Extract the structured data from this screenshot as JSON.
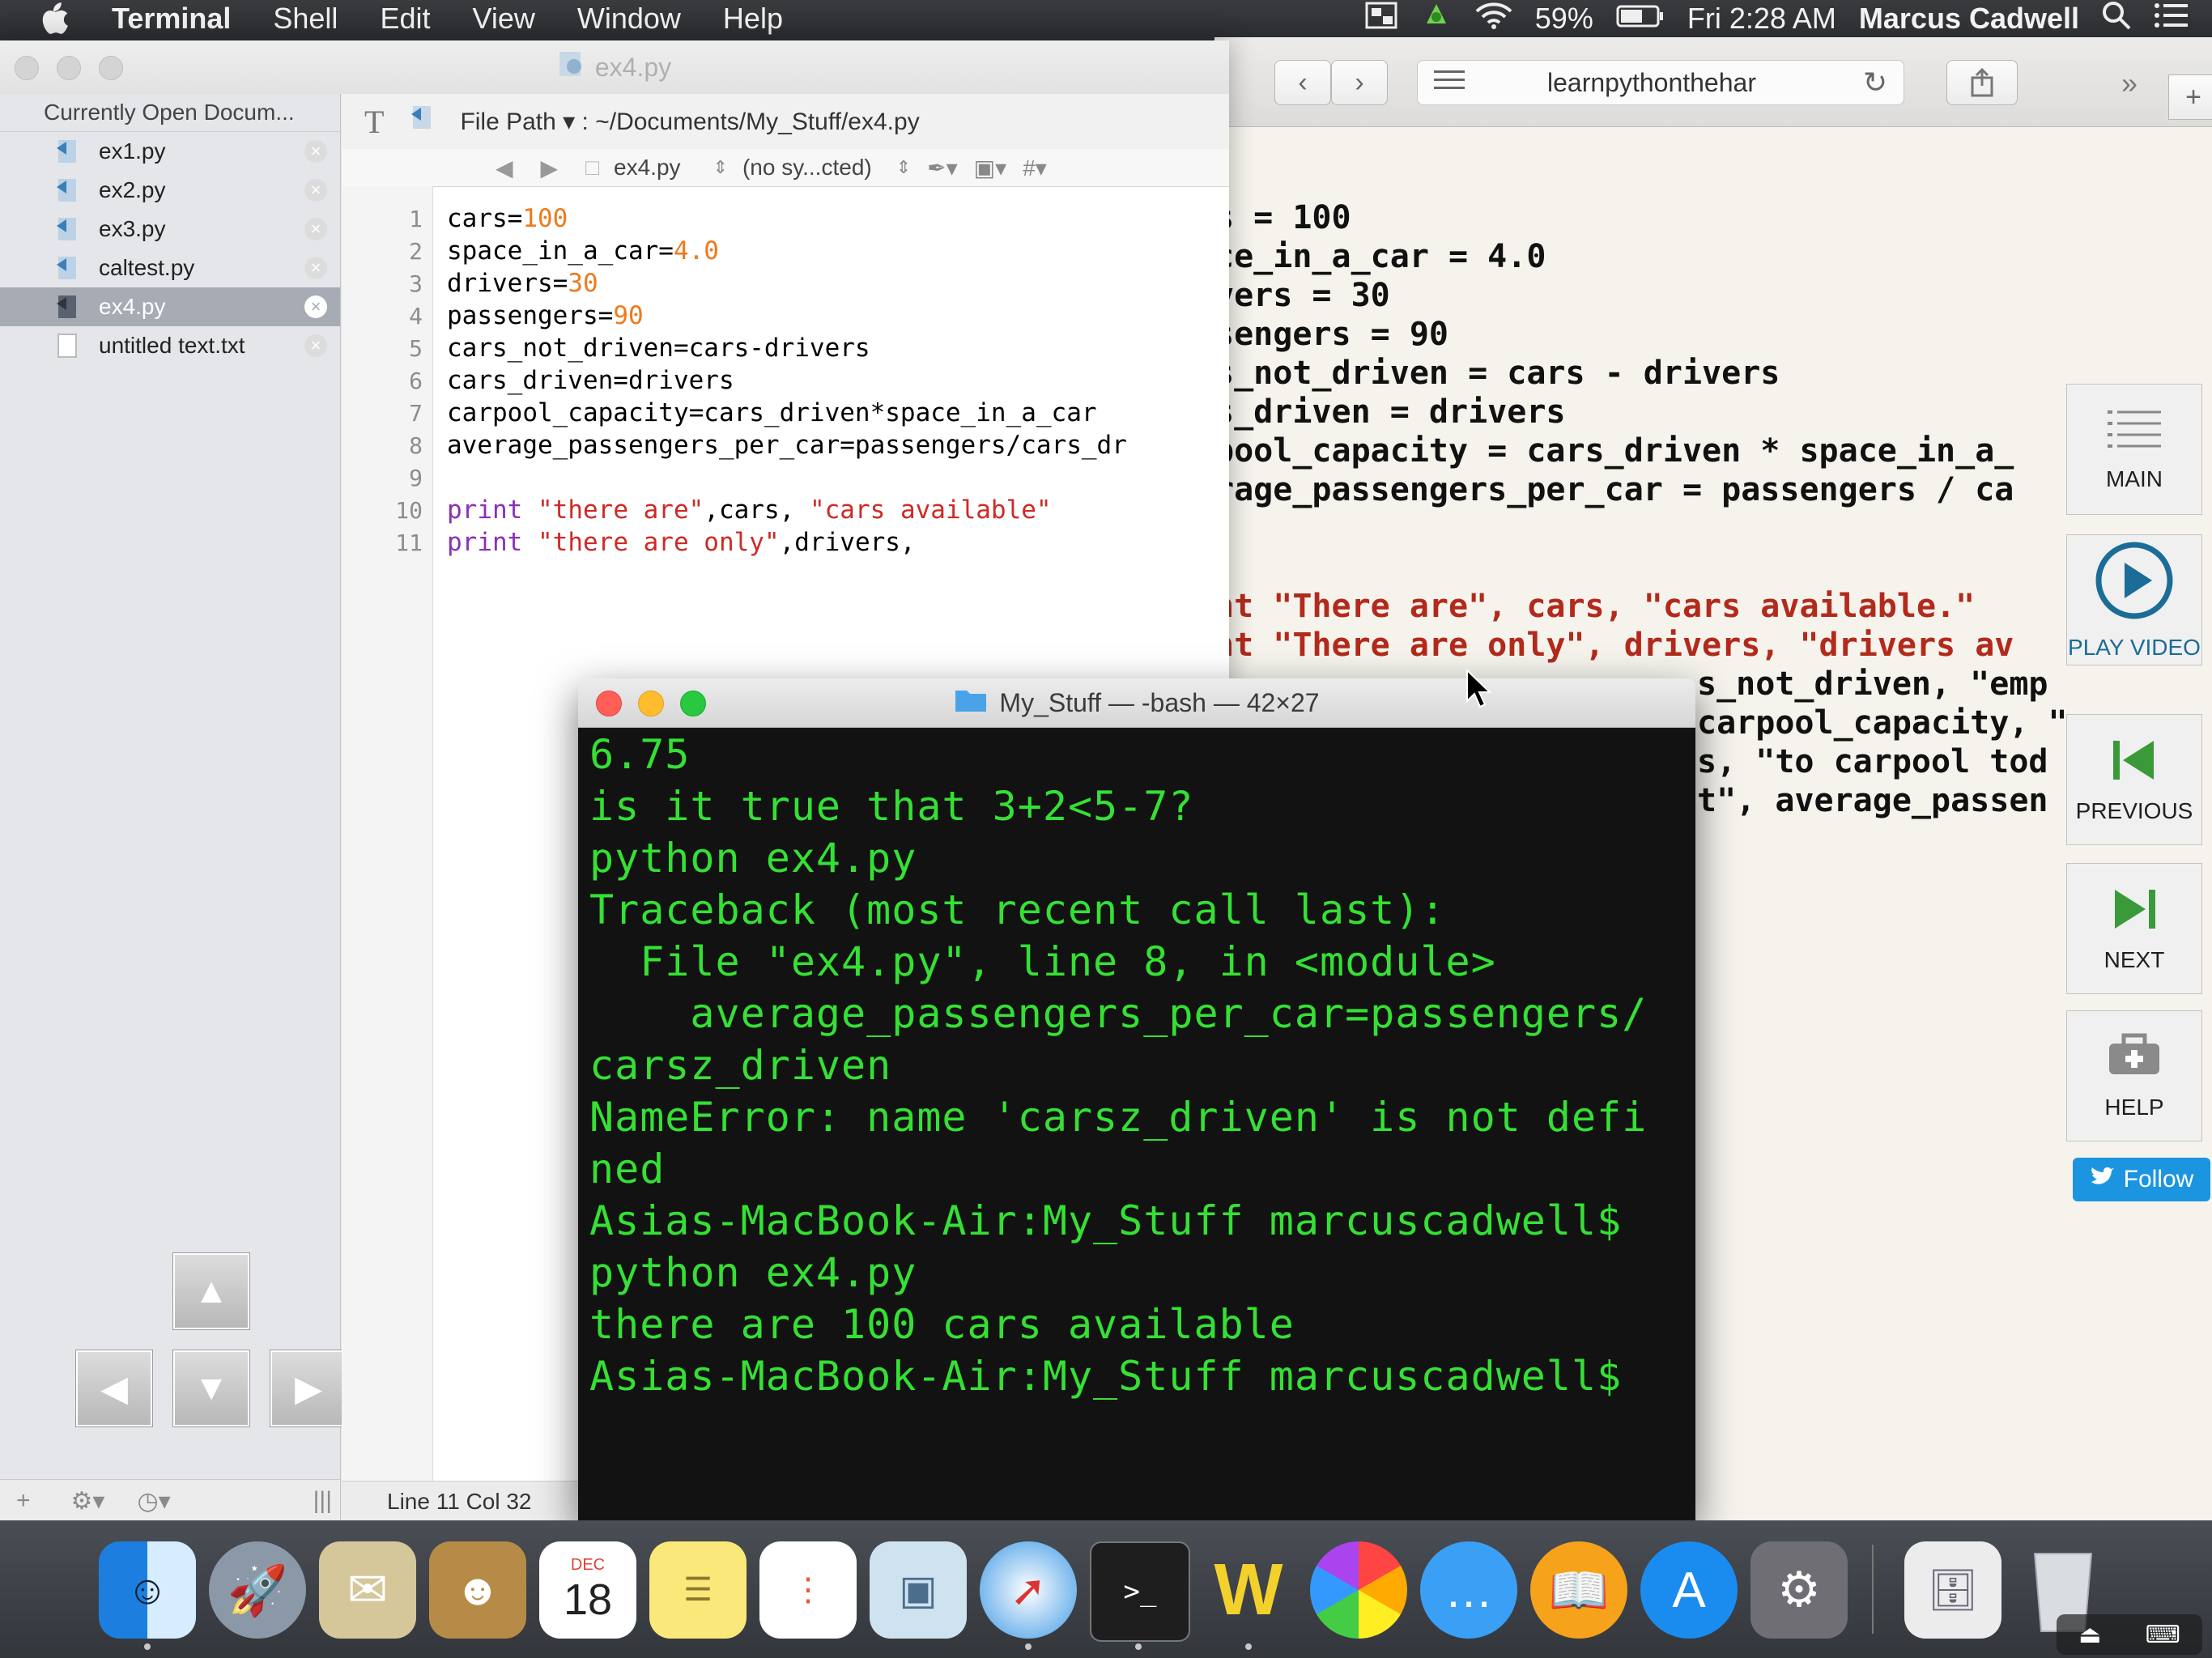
{
  "menubar": {
    "app": "Terminal",
    "menus": [
      "Shell",
      "Edit",
      "View",
      "Window",
      "Help"
    ],
    "battery": "59%",
    "clock": "Fri 2:28 AM",
    "user": "Marcus Cadwell"
  },
  "browser": {
    "address": "learnpythonthehar",
    "code": [
      "s = 100",
      "ce_in_a_car = 4.0",
      "vers = 30",
      "sengers = 90",
      "s_not_driven = cars - drivers",
      "s_driven = drivers",
      "pool_capacity = cars_driven * space_in_a_",
      "rage_passengers_per_car = passengers / ca",
      "",
      "nt \"There are\", cars, \"cars available.\"",
      "nt \"There are only\", drivers, \"drivers av",
      "s_not_driven, \"emp",
      "carpool_capacity, \"",
      "s, \"to carpool tod",
      "t\", average_passen"
    ],
    "sidebar": {
      "main": "MAIN",
      "play": "PLAY VIDEO",
      "previous": "PREVIOUS",
      "next": "NEXT",
      "help": "HELP",
      "follow": "Follow"
    }
  },
  "editor": {
    "title": "ex4.py",
    "sidebar_header": "Currently Open Docum...",
    "files": [
      "ex1.py",
      "ex2.py",
      "ex3.py",
      "caltest.py",
      "ex4.py",
      "untitled text.txt"
    ],
    "selected_file": "ex4.py",
    "path_label": "File Path ▾ : ~/Documents/My_Stuff/ex4.py",
    "nav_file": "ex4.py",
    "nav_symbol": "(no sy...cted)",
    "status": "Line 11 Col 32",
    "line_numbers": [
      "1",
      "2",
      "3",
      "4",
      "5",
      "6",
      "7",
      "8",
      "9",
      "10",
      "11"
    ]
  },
  "terminal": {
    "title": "My_Stuff — -bash — 42×27",
    "lines": [
      "6.75",
      "is it true that 3+2<5-7?",
      "python ex4.py",
      "Traceback (most recent call last):",
      "  File \"ex4.py\", line 8, in <module>",
      "    average_passengers_per_car=passengers/",
      "carsz_driven",
      "NameError: name 'carsz_driven' is not defi",
      "ned",
      "Asias-MacBook-Air:My_Stuff marcuscadwell$",
      "python ex4.py",
      "there are 100 cars available",
      "Asias-MacBook-Air:My_Stuff marcuscadwell$"
    ]
  },
  "dock": {
    "calendar_month": "DEC",
    "calendar_day": "18"
  },
  "colors": {
    "terminal_text": "#35e034",
    "terminal_bg": "#121212",
    "selection": "#a6abb4",
    "follow_button": "#1b95e0"
  }
}
